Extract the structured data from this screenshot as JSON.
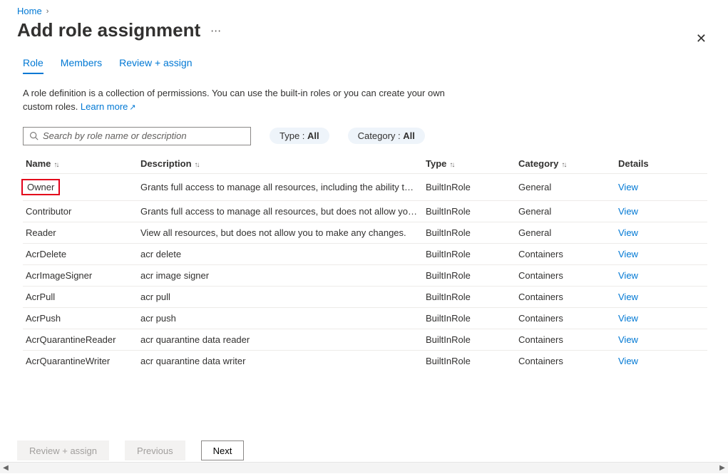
{
  "breadcrumb": {
    "home": "Home"
  },
  "title": "Add role assignment",
  "tabs": {
    "role": "Role",
    "members": "Members",
    "review": "Review + assign"
  },
  "description": "A role definition is a collection of permissions. You can use the built-in roles or you can create your own custom roles. ",
  "learn_more": "Learn more",
  "search": {
    "placeholder": "Search by role name or description"
  },
  "filters": {
    "type_label": "Type : ",
    "type_value": "All",
    "category_label": "Category : ",
    "category_value": "All"
  },
  "columns": {
    "name": "Name",
    "description": "Description",
    "type": "Type",
    "category": "Category",
    "details": "Details"
  },
  "view_label": "View",
  "roles": [
    {
      "name": "Owner",
      "description": "Grants full access to manage all resources, including the ability to a...",
      "type": "BuiltInRole",
      "category": "General",
      "highlighted": true
    },
    {
      "name": "Contributor",
      "description": "Grants full access to manage all resources, but does not allow you ...",
      "type": "BuiltInRole",
      "category": "General"
    },
    {
      "name": "Reader",
      "description": "View all resources, but does not allow you to make any changes.",
      "type": "BuiltInRole",
      "category": "General"
    },
    {
      "name": "AcrDelete",
      "description": "acr delete",
      "type": "BuiltInRole",
      "category": "Containers"
    },
    {
      "name": "AcrImageSigner",
      "description": "acr image signer",
      "type": "BuiltInRole",
      "category": "Containers"
    },
    {
      "name": "AcrPull",
      "description": "acr pull",
      "type": "BuiltInRole",
      "category": "Containers"
    },
    {
      "name": "AcrPush",
      "description": "acr push",
      "type": "BuiltInRole",
      "category": "Containers"
    },
    {
      "name": "AcrQuarantineReader",
      "description": "acr quarantine data reader",
      "type": "BuiltInRole",
      "category": "Containers"
    },
    {
      "name": "AcrQuarantineWriter",
      "description": "acr quarantine data writer",
      "type": "BuiltInRole",
      "category": "Containers"
    }
  ],
  "footer": {
    "review": "Review + assign",
    "previous": "Previous",
    "next": "Next"
  }
}
